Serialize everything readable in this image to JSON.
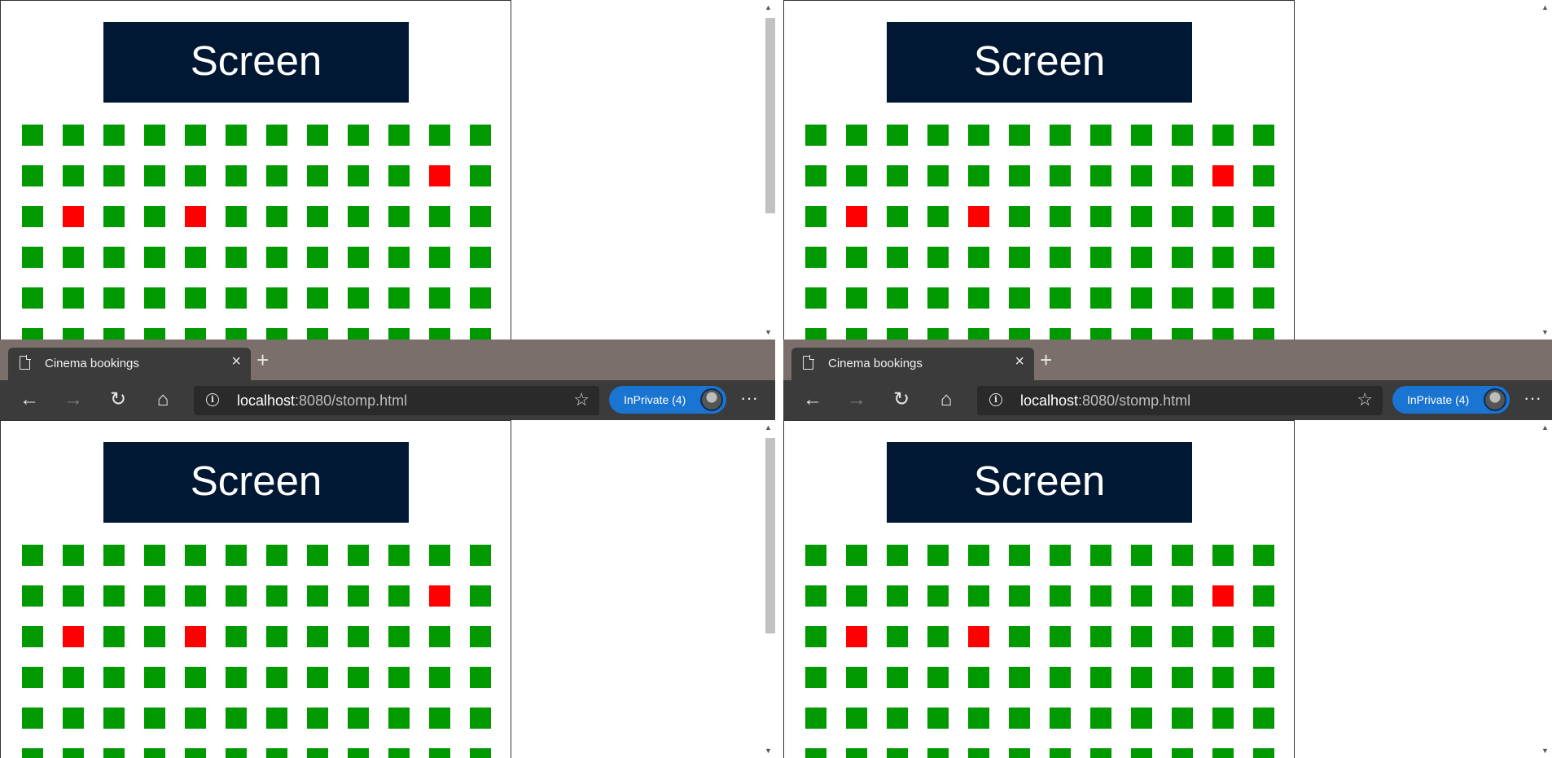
{
  "browser": {
    "tab_title": "Cinema bookings",
    "tab_close": "×",
    "new_tab": "+",
    "url_host": "localhost",
    "url_path": ":8080/stomp.html",
    "inprivate_label": "InPrivate (4)",
    "nav": {
      "back": "←",
      "forward": "→",
      "refresh": "↻",
      "home": "⌂"
    },
    "window": {
      "minimize": "—",
      "maximize": "☐",
      "close": "✕"
    },
    "more": "···",
    "star": "☆",
    "info": "i"
  },
  "page": {
    "screen_label": "Screen",
    "rows_shown": 6,
    "seats_per_row": 12,
    "taken_seats": [
      {
        "row": 2,
        "seat": 11
      },
      {
        "row": 3,
        "seat": 2
      },
      {
        "row": 3,
        "seat": 5
      }
    ]
  },
  "colors": {
    "seat_free": "#009900",
    "seat_taken": "#ff0000",
    "screen_bg": "#001833",
    "inprivate": "#1a74d2",
    "tabstrip": "#7a6f6a",
    "toolbar": "#3b3b3b"
  },
  "windows": [
    {
      "name": "top-left",
      "show_chrome": false,
      "scroll_thumb_shown": true
    },
    {
      "name": "top-right",
      "show_chrome": false,
      "scroll_thumb_shown": false
    },
    {
      "name": "bottom-left",
      "show_chrome": true,
      "scroll_thumb_shown": true
    },
    {
      "name": "bottom-right",
      "show_chrome": true,
      "scroll_thumb_shown": false
    }
  ]
}
